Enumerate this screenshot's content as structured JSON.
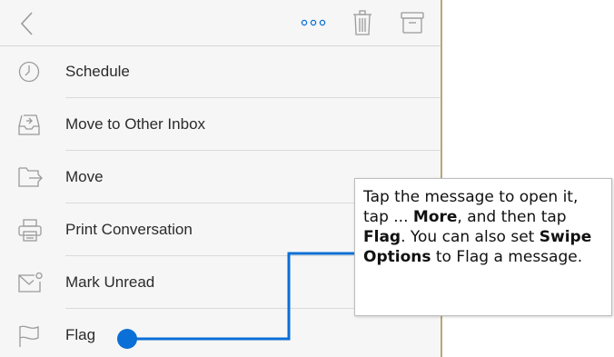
{
  "toolbar": {
    "back_icon": "chevron-left-icon",
    "more_icon": "ellipsis-icon",
    "trash_icon": "trash-icon",
    "archive_icon": "archive-icon"
  },
  "menu": {
    "items": [
      {
        "label": "Schedule",
        "icon": "clock-icon"
      },
      {
        "label": "Move to Other Inbox",
        "icon": "inbox-move-icon"
      },
      {
        "label": "Move",
        "icon": "folder-move-icon"
      },
      {
        "label": "Print Conversation",
        "icon": "printer-icon"
      },
      {
        "label": "Mark Unread",
        "icon": "envelope-unread-icon"
      },
      {
        "label": "Flag",
        "icon": "flag-icon"
      }
    ]
  },
  "callout": {
    "t1": "Tap the message to open it, tap ... ",
    "b1": "More",
    "t2": ", and then tap ",
    "b2": "Flag",
    "t3": ". You can also set ",
    "b3": "Swipe Options",
    "t4": " to Flag a message."
  },
  "colors": {
    "accent": "#0a6fd6",
    "frame": "#b8a878",
    "icon_gray": "#9a9a9a"
  }
}
